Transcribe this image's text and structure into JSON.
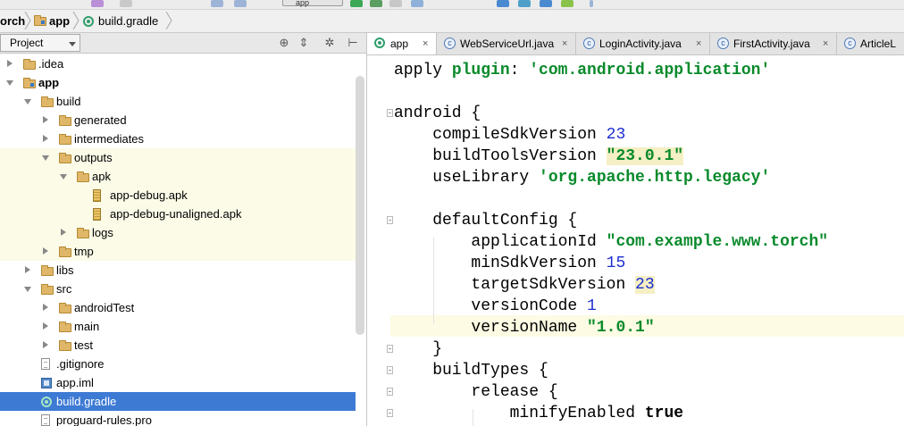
{
  "breadcrumb": {
    "items": [
      "orch",
      "app",
      "build.gradle"
    ]
  },
  "toolbar": {
    "run_config": "app"
  },
  "project_panel": {
    "view_mode": "Project",
    "tree": [
      {
        "label": ".idea",
        "depth": 0,
        "kind": "folder",
        "arrow": "closed",
        "hl": false,
        "sel": false
      },
      {
        "label": "app",
        "depth": 0,
        "kind": "module",
        "arrow": "open",
        "hl": false,
        "sel": false,
        "bold": true
      },
      {
        "label": "build",
        "depth": 1,
        "kind": "folder",
        "arrow": "open",
        "hl": false,
        "sel": false
      },
      {
        "label": "generated",
        "depth": 2,
        "kind": "folder",
        "arrow": "closed",
        "hl": false,
        "sel": false
      },
      {
        "label": "intermediates",
        "depth": 2,
        "kind": "folder",
        "arrow": "closed",
        "hl": false,
        "sel": false
      },
      {
        "label": "outputs",
        "depth": 2,
        "kind": "folder",
        "arrow": "open",
        "hl": true,
        "sel": false
      },
      {
        "label": "apk",
        "depth": 3,
        "kind": "folder",
        "arrow": "open",
        "hl": true,
        "sel": false
      },
      {
        "label": "app-debug.apk",
        "depth": 4,
        "kind": "apk",
        "arrow": "none",
        "hl": true,
        "sel": false
      },
      {
        "label": "app-debug-unaligned.apk",
        "depth": 4,
        "kind": "apk",
        "arrow": "none",
        "hl": true,
        "sel": false
      },
      {
        "label": "logs",
        "depth": 3,
        "kind": "folder",
        "arrow": "closed",
        "hl": true,
        "sel": false
      },
      {
        "label": "tmp",
        "depth": 2,
        "kind": "folder",
        "arrow": "closed",
        "hl": true,
        "sel": false
      },
      {
        "label": "libs",
        "depth": 1,
        "kind": "folder",
        "arrow": "closed",
        "hl": false,
        "sel": false
      },
      {
        "label": "src",
        "depth": 1,
        "kind": "folder",
        "arrow": "open",
        "hl": false,
        "sel": false
      },
      {
        "label": "androidTest",
        "depth": 2,
        "kind": "folder",
        "arrow": "closed",
        "hl": false,
        "sel": false
      },
      {
        "label": "main",
        "depth": 2,
        "kind": "folder",
        "arrow": "closed",
        "hl": false,
        "sel": false
      },
      {
        "label": "test",
        "depth": 2,
        "kind": "folder",
        "arrow": "closed",
        "hl": false,
        "sel": false
      },
      {
        "label": ".gitignore",
        "depth": 1,
        "kind": "file",
        "arrow": "none",
        "hl": false,
        "sel": false
      },
      {
        "label": "app.iml",
        "depth": 1,
        "kind": "iml",
        "arrow": "none",
        "hl": false,
        "sel": false
      },
      {
        "label": "build.gradle",
        "depth": 1,
        "kind": "gradle",
        "arrow": "none",
        "hl": false,
        "sel": true
      },
      {
        "label": "proguard-rules.pro",
        "depth": 1,
        "kind": "file",
        "arrow": "none",
        "hl": false,
        "sel": false
      }
    ]
  },
  "editor": {
    "tabs": [
      {
        "label": "app",
        "icon": "gradle",
        "active": true,
        "close": "×"
      },
      {
        "label": "WebServiceUrl.java",
        "icon": "java",
        "active": false,
        "close": "×"
      },
      {
        "label": "LoginActivity.java",
        "icon": "java",
        "active": false,
        "close": "×"
      },
      {
        "label": "FirstActivity.java",
        "icon": "java",
        "active": false,
        "close": "×"
      },
      {
        "label": "ArticleL",
        "icon": "java",
        "active": false,
        "close": ""
      }
    ],
    "lines": [
      [
        {
          "t": "apply "
        },
        {
          "t": "plugin",
          "c": "g"
        },
        {
          "t": ": "
        },
        {
          "t": "'com.android.application'",
          "c": "g"
        }
      ],
      [],
      [
        {
          "t": "android {"
        }
      ],
      [
        {
          "t": "    compileSdkVersion "
        },
        {
          "t": "23",
          "c": "n"
        }
      ],
      [
        {
          "t": "    buildToolsVersion "
        },
        {
          "t": "\"23.0.1\"",
          "c": "g hlw"
        }
      ],
      [
        {
          "t": "    useLibrary "
        },
        {
          "t": "'org.apache.http.legacy'",
          "c": "g"
        }
      ],
      [],
      [
        {
          "t": "    defaultConfig {"
        }
      ],
      [
        {
          "t": "        applicationId "
        },
        {
          "t": "\"com.example.www.torch\"",
          "c": "g"
        }
      ],
      [
        {
          "t": "        minSdkVersion "
        },
        {
          "t": "15",
          "c": "n"
        }
      ],
      [
        {
          "t": "        targetSdkVersion "
        },
        {
          "t": "23",
          "c": "n hlw"
        }
      ],
      [
        {
          "t": "        versionCode "
        },
        {
          "t": "1",
          "c": "n"
        }
      ],
      [
        {
          "t": "        versionName "
        },
        {
          "t": "\"1.0.1\"",
          "c": "g"
        }
      ],
      [
        {
          "t": "    }"
        }
      ],
      [
        {
          "t": "    buildTypes {"
        }
      ],
      [
        {
          "t": "        release {"
        }
      ],
      [
        {
          "t": "            minifyEnabled "
        },
        {
          "t": "true",
          "c": "k"
        }
      ]
    ]
  }
}
